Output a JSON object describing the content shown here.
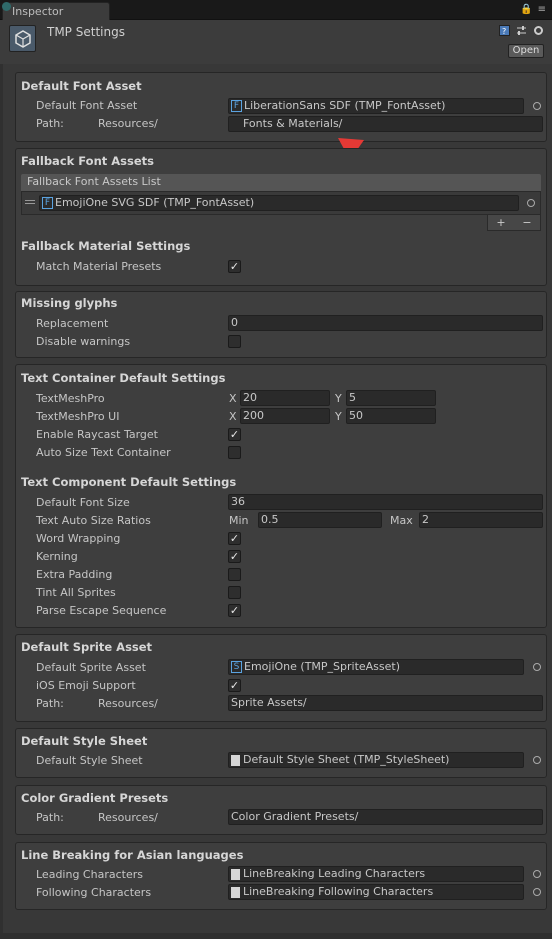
{
  "tab": {
    "title": "Inspector"
  },
  "header": {
    "title": "TMP Settings",
    "open_label": "Open"
  },
  "default_font": {
    "title": "Default Font Asset",
    "font_label": "Default Font Asset",
    "font_value": "LiberationSans SDF (TMP_FontAsset)",
    "path_label": "Path:",
    "path_prefix": "Resources/",
    "path_value": "Fonts & Materials/"
  },
  "fallback": {
    "title": "Fallback Font Assets",
    "list_header": "Fallback Font Assets List",
    "item": "EmojiOne SVG SDF (TMP_FontAsset)",
    "add": "+",
    "remove": "−"
  },
  "fallback_material": {
    "title": "Fallback Material Settings",
    "match_label": "Match Material Presets",
    "match_checked": true
  },
  "missing": {
    "title": "Missing glyphs",
    "replacement_label": "Replacement",
    "replacement_value": "0",
    "disable_label": "Disable warnings",
    "disable_checked": false
  },
  "text_container": {
    "title": "Text Container Default Settings",
    "tmp_label": "TextMeshPro",
    "tmp_x": "20",
    "tmp_y": "5",
    "tmpui_label": "TextMeshPro UI",
    "tmpui_x": "200",
    "tmpui_y": "50",
    "x": "X",
    "y": "Y",
    "raycast_label": "Enable Raycast Target",
    "raycast_checked": true,
    "autosize_label": "Auto Size Text Container",
    "autosize_checked": false
  },
  "text_component": {
    "title": "Text Component Default Settings",
    "font_size_label": "Default Font Size",
    "font_size_value": "36",
    "ratios_label": "Text Auto Size Ratios",
    "min_label": "Min",
    "min_value": "0.5",
    "max_label": "Max",
    "max_value": "2",
    "word_wrap_label": "Word Wrapping",
    "word_wrap_checked": true,
    "kerning_label": "Kerning",
    "kerning_checked": true,
    "extra_padding_label": "Extra Padding",
    "extra_padding_checked": false,
    "tint_label": "Tint All Sprites",
    "tint_checked": false,
    "parse_label": "Parse Escape Sequence",
    "parse_checked": true
  },
  "sprite": {
    "title": "Default Sprite Asset",
    "asset_label": "Default Sprite Asset",
    "asset_value": "EmojiOne (TMP_SpriteAsset)",
    "ios_label": "iOS Emoji Support",
    "ios_checked": true,
    "path_label": "Path:",
    "path_prefix": "Resources/",
    "path_value": "Sprite Assets/"
  },
  "style": {
    "title": "Default Style Sheet",
    "label": "Default Style Sheet",
    "value": "Default Style Sheet (TMP_StyleSheet)"
  },
  "gradient": {
    "title": "Color Gradient Presets",
    "path_label": "Path:",
    "path_prefix": "Resources/",
    "path_value": "Color Gradient Presets/"
  },
  "line_breaking": {
    "title": "Line Breaking for Asian languages",
    "leading_label": "Leading Characters",
    "leading_value": "LineBreaking Leading Characters",
    "following_label": "Following Characters",
    "following_value": "LineBreaking Following Characters"
  },
  "colors": {
    "arrow": "#e53935",
    "panel": "#3e3e3e",
    "field": "#2a2a2a"
  }
}
